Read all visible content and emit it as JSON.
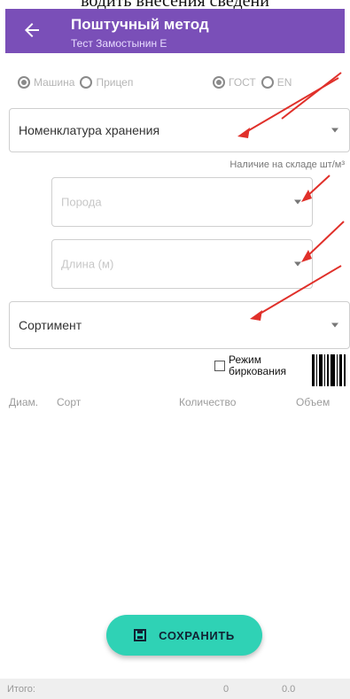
{
  "top_cut_text": "водить внесения сведени",
  "appbar": {
    "title": "Поштучный метод",
    "subtitle": "Тест Замостынин Е"
  },
  "radios": [
    {
      "label": "Машина",
      "checked": true
    },
    {
      "label": "Прицеп",
      "checked": false
    },
    {
      "label": "ГОСТ",
      "checked": true
    },
    {
      "label": "EN",
      "checked": false
    }
  ],
  "fields": {
    "storage_nomenclature": "Номенклатура хранения",
    "stock_label": "Наличие на складе шт/м³",
    "species_placeholder": "Порода",
    "length_placeholder": "Длина (м)",
    "assortment": "Сортимент"
  },
  "tagging": {
    "label": "Режим биркования",
    "checked": false
  },
  "table": {
    "headers": [
      "Диам.",
      "Сорт",
      "Количество",
      "Объем"
    ]
  },
  "save_button": {
    "label": "СОХРАНИТЬ"
  },
  "footer": {
    "label": "Итого:",
    "count": "0",
    "volume": "0.0"
  },
  "colors": {
    "appbar": "#7a4fb8",
    "save_button": "#2fd2b5",
    "annotation_arrows": "#e0302a"
  }
}
